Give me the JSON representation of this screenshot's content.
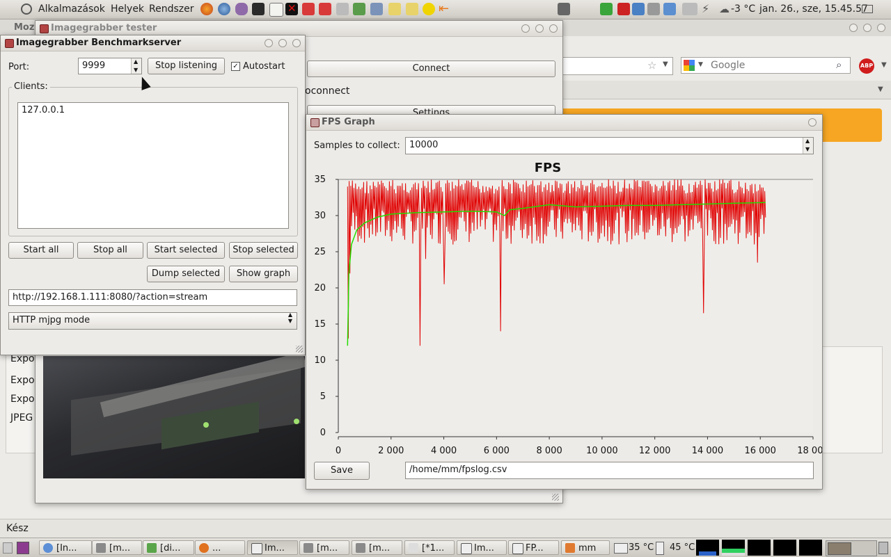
{
  "top_panel": {
    "menus": [
      "Alkalmazások",
      "Helyek",
      "Rendszer"
    ],
    "weather": "-3 °C",
    "clock": "jan. 26., sze, 15.45.57"
  },
  "browser": {
    "tab_partial": "Moz",
    "search_placeholder": "Google",
    "status": "Kész",
    "abp": "ABP",
    "list_items": [
      "Expo",
      "Expo",
      "Expo",
      "JPEG"
    ]
  },
  "tester": {
    "title": "Imagegrabber tester",
    "connect_label": "Connect",
    "autoconnect_partial": "oconnect",
    "settings_partial": "Settings"
  },
  "bench": {
    "title": "Imagegrabber Benchmarkserver",
    "port_label": "Port:",
    "port_value": "9999",
    "stop_listening": "Stop listening",
    "autostart_label": "Autostart",
    "clients_label": "Clients:",
    "clients": [
      "127.0.0.1"
    ],
    "start_all": "Start all",
    "stop_all": "Stop all",
    "start_selected": "Start selected",
    "stop_selected": "Stop selected",
    "dump_selected": "Dump selected",
    "show_graph": "Show graph",
    "url": "http://192.168.1.111:8080/?action=stream",
    "mode": "HTTP mjpg mode"
  },
  "fps_window": {
    "title": "FPS Graph",
    "samples_label": "Samples to collect:",
    "samples_value": "10000",
    "save_label": "Save",
    "path": "/home/mm/fpslog.csv"
  },
  "chart_data": {
    "type": "line",
    "title": "FPS",
    "xlim": [
      0,
      18000
    ],
    "ylim": [
      0,
      35
    ],
    "xticks": [
      0,
      2000,
      4000,
      6000,
      8000,
      10000,
      12000,
      14000,
      16000,
      18000
    ],
    "xtick_labels": [
      "0",
      "2 000",
      "4 000",
      "6 000",
      "8 000",
      "10 000",
      "12 000",
      "14 000",
      "16 000",
      "18 000"
    ],
    "yticks": [
      0,
      5,
      10,
      15,
      20,
      25,
      30,
      35
    ],
    "series": [
      {
        "color": "#e00000",
        "x_range": [
          350,
          16200
        ],
        "band": [
          26,
          35
        ],
        "spikes": [
          [
            380,
            13
          ],
          [
            450,
            22
          ],
          [
            3100,
            12
          ],
          [
            3300,
            24
          ],
          [
            4000,
            20.5
          ],
          [
            6150,
            14
          ],
          [
            13850,
            16.5
          ],
          [
            15900,
            23.5
          ]
        ]
      },
      {
        "color": "#22dd00",
        "points": [
          [
            350,
            12
          ],
          [
            400,
            22
          ],
          [
            500,
            26
          ],
          [
            700,
            28
          ],
          [
            1000,
            29
          ],
          [
            1500,
            29.8
          ],
          [
            2000,
            30.2
          ],
          [
            3000,
            30.4
          ],
          [
            4000,
            30.5
          ],
          [
            5000,
            30.6
          ],
          [
            6000,
            30.5
          ],
          [
            6300,
            30
          ],
          [
            6500,
            30.8
          ],
          [
            7000,
            31
          ],
          [
            8000,
            31.5
          ],
          [
            9000,
            31.2
          ],
          [
            10000,
            31.3
          ],
          [
            11000,
            31.4
          ],
          [
            12000,
            31.4
          ],
          [
            13000,
            31.5
          ],
          [
            14000,
            31.6
          ],
          [
            15000,
            31.7
          ],
          [
            16200,
            31.8
          ]
        ]
      }
    ]
  },
  "taskbar": {
    "tasks": [
      "[In...",
      "[m...",
      "[di...",
      "...",
      "Im...",
      "[m...",
      "[m...",
      "[*1...",
      "Im...",
      "FP...",
      "mm"
    ],
    "temp1": "35 °C",
    "temp2": "45 °C"
  }
}
